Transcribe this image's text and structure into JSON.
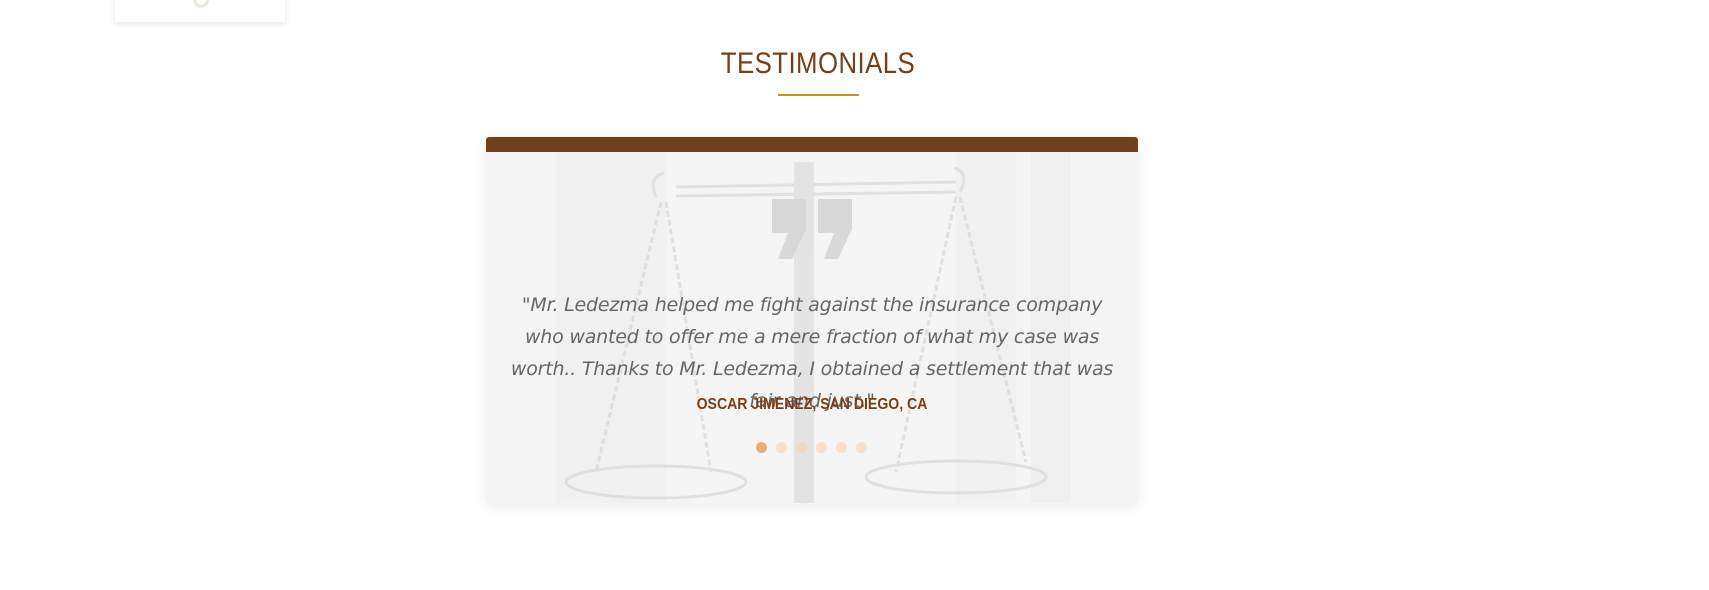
{
  "section": {
    "title": "TESTIMONIALS"
  },
  "testimonial": {
    "quote": "\"Mr. Ledezma helped me fight against the insurance company who wanted to offer me a mere fraction of what my case was worth.. Thanks to Mr. Ledezma, I obtained a settlement that was fair and just.\"",
    "author": "OSCAR JIMENEZ, SAN DIEGO, CA"
  },
  "carousel": {
    "slide_count": 6,
    "active_index": 0
  },
  "colors": {
    "title": "#75401b",
    "underline": "#c9931d",
    "topbar": "#74401b",
    "author": "#7a3e17",
    "dot_active": "#ebae72",
    "dot_inactive": "#f3d2b3"
  },
  "icons": {
    "quote": "quote-icon",
    "background": "scales-of-justice"
  }
}
